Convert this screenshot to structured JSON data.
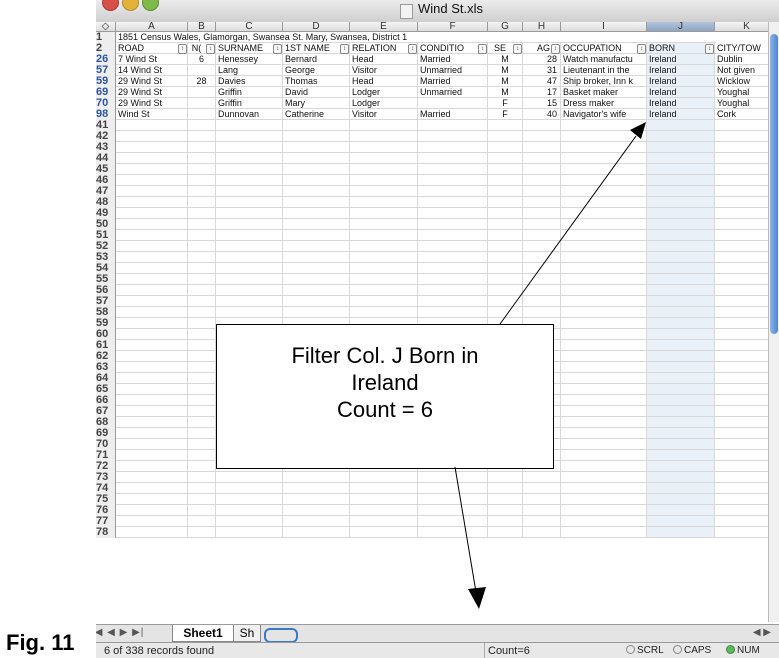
{
  "window": {
    "title": "Wind St.xls"
  },
  "columns": [
    "A",
    "B",
    "C",
    "D",
    "E",
    "F",
    "G",
    "H",
    "I",
    "J",
    "K"
  ],
  "title_row": {
    "num": "1",
    "text": "1851 Census Wales, Glamorgan, Swansea St. Mary, Swansea, District 1"
  },
  "header_row": {
    "num": "2",
    "cells": [
      "ROAD",
      "N(",
      "SURNAME",
      "1ST NAME",
      "RELATION",
      "CONDITIO",
      "SE",
      "AG",
      "OCCUPATION",
      "BORN",
      "CITY/TOW"
    ]
  },
  "data_rows": [
    {
      "num": "26",
      "cells": [
        "7 Wind St",
        "6",
        "Henessey",
        "Bernard",
        "Head",
        "Married",
        "M",
        "28",
        "Watch manufactu",
        "Ireland",
        "Dublin"
      ]
    },
    {
      "num": "57",
      "cells": [
        "14 Wind St",
        "",
        "Lang",
        "George",
        "Visitor",
        "Unmarried",
        "M",
        "31",
        "Lieutenant in the",
        "Ireland",
        "Not given"
      ]
    },
    {
      "num": "59",
      "cells": [
        "29 Wind St",
        "28",
        "Davies",
        "Thomas",
        "Head",
        "Married",
        "M",
        "47",
        "Ship broker, Inn k",
        "Ireland",
        "Wicklow"
      ]
    },
    {
      "num": "69",
      "cells": [
        "29 Wind St",
        "",
        "Griffin",
        "David",
        "Lodger",
        "Unmarried",
        "M",
        "17",
        "Basket maker",
        "Ireland",
        "Youghal"
      ]
    },
    {
      "num": "70",
      "cells": [
        "29 Wind St",
        "",
        "Griffin",
        "Mary",
        "Lodger",
        "",
        "F",
        "15",
        "Dress maker",
        "Ireland",
        "Youghal"
      ]
    },
    {
      "num": "98",
      "cells": [
        "Wind St",
        "",
        "Dunnovan",
        "Catherine",
        "Visitor",
        "Married",
        "F",
        "40",
        "Navigator's wife",
        "Ireland",
        "Cork"
      ]
    }
  ],
  "empty_rows": [
    "41",
    "42",
    "43",
    "44",
    "45",
    "46",
    "47",
    "48",
    "49",
    "50",
    "51",
    "52",
    "53",
    "54",
    "55",
    "56",
    "57",
    "58",
    "59",
    "60",
    "61",
    "62",
    "63",
    "64",
    "65",
    "66",
    "67",
    "68",
    "69",
    "70",
    "71",
    "72",
    "73",
    "74",
    "75",
    "76",
    "77",
    "78"
  ],
  "sheet_tabs": {
    "tab1": "Sheet1",
    "tab2": "Sh"
  },
  "status": {
    "message": "6 of 338 records found",
    "count": "Count=6",
    "scrl": "SCRL",
    "caps": "CAPS",
    "num": "NUM"
  },
  "callout": {
    "line1": "Filter Col. J Born in",
    "line2": "Ireland",
    "line3": "Count = 6"
  },
  "figure_label": "Fig. 11",
  "filter_button_glyph": "↕",
  "colors": {
    "selected_column": "#eaf0f8",
    "filtered_row_number": "#2d55a6",
    "scroll_blue": "#4d85d1"
  }
}
